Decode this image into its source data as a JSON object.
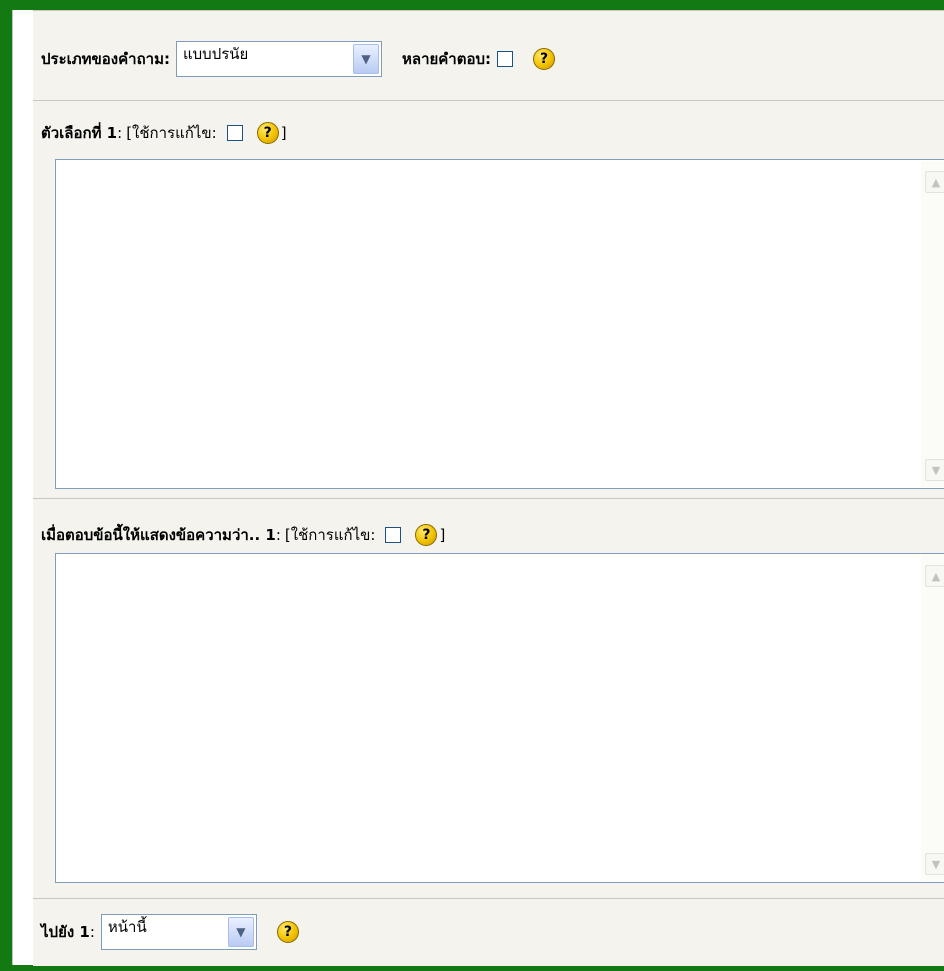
{
  "question_type": {
    "label": "ประเภทของคำถาม:",
    "select_value": "แบบปรนัย",
    "multi_answer_label": "หลายคำตอบ:",
    "multi_answer_checked": false
  },
  "choice": {
    "label": "ตัวเลือกที่ 1",
    "colon": ":",
    "editor_prefix": "[ใช้การแก้ไข:",
    "editor_suffix": "]",
    "content": ""
  },
  "feedback": {
    "label": "เมื่อตอบข้อนี้ให้แสดงข้อความว่า.. 1",
    "colon": ":",
    "editor_prefix": "[ใช้การแก้ไข:",
    "editor_suffix": "]",
    "content": ""
  },
  "jump": {
    "label": "ไปยัง 1",
    "colon": ":",
    "select_value": "หน้านี้"
  },
  "icons": {
    "help": "?",
    "dropdown": "▼",
    "scroll_up": "▲",
    "scroll_down": "▼"
  },
  "colors": {
    "frame_green": "#137a13",
    "row_background": "#f4f3ee",
    "field_border": "#7f9db9",
    "help_yellow": "#f2c200"
  }
}
